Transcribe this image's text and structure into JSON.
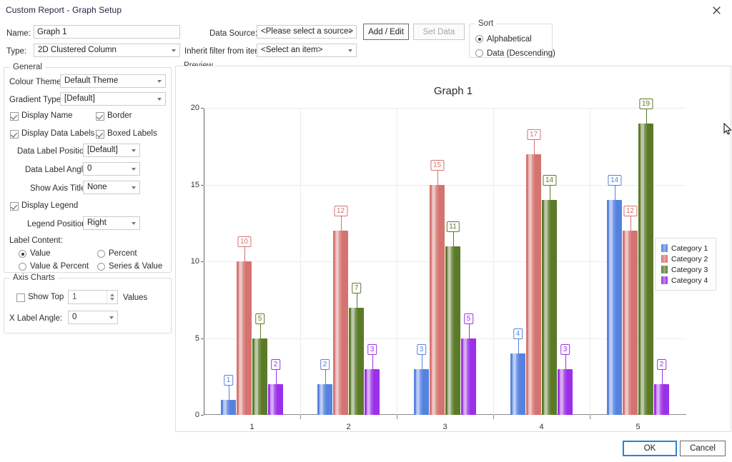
{
  "window": {
    "title": "Custom Report - Graph Setup",
    "close_icon": "close-icon"
  },
  "form": {
    "name_label": "Name:",
    "name_value": "Graph 1",
    "type_label": "Type:",
    "type_value": "2D Clustered Column",
    "data_source_label": "Data Source:",
    "data_source_value": "<Please select a source>",
    "inherit_filter_label": "Inherit filter from item:",
    "inherit_filter_value": "<Select an item>",
    "add_edit_label": "Add / Edit",
    "set_data_label": "Set Data"
  },
  "sort": {
    "title": "Sort",
    "options": [
      {
        "label": "Alphabetical",
        "selected": true
      },
      {
        "label": "Data (Descending)",
        "selected": false
      }
    ]
  },
  "general": {
    "title": "General",
    "colour_theme_label": "Colour Theme:",
    "colour_theme_value": "Default Theme",
    "gradient_type_label": "Gradient Type:",
    "gradient_type_value": "[Default]",
    "display_name_label": "Display Name",
    "display_name_checked": true,
    "border_label": "Border",
    "border_checked": true,
    "display_data_labels_label": "Display Data Labels",
    "display_data_labels_checked": true,
    "boxed_labels_label": "Boxed Labels",
    "boxed_labels_checked": true,
    "data_label_position_label": "Data Label Position:",
    "data_label_position_value": "[Default]",
    "data_label_angle_label": "Data Label Angle:",
    "data_label_angle_value": "0",
    "show_axis_titles_label": "Show Axis Titles:",
    "show_axis_titles_value": "None",
    "display_legend_label": "Display Legend",
    "display_legend_checked": true,
    "legend_position_label": "Legend Position:",
    "legend_position_value": "Right",
    "label_content_label": "Label Content:",
    "label_content_options": [
      {
        "label": "Value",
        "selected": true
      },
      {
        "label": "Percent",
        "selected": false
      },
      {
        "label": "Value & Percent",
        "selected": false
      },
      {
        "label": "Series & Value",
        "selected": false
      }
    ]
  },
  "axis_charts": {
    "title": "Axis Charts",
    "show_top_label": "Show Top",
    "show_top_checked": false,
    "show_top_value": "1",
    "values_label": "Values",
    "x_label_angle_label": "X Label Angle:",
    "x_label_angle_value": "0"
  },
  "preview": {
    "title": "Preview"
  },
  "footer": {
    "ok_label": "OK",
    "cancel_label": "Cancel"
  },
  "chart_data": {
    "type": "bar",
    "title": "Graph 1",
    "xlabel": "",
    "ylabel": "",
    "categories": [
      "1",
      "2",
      "3",
      "4",
      "5"
    ],
    "series": [
      {
        "name": "Category 1",
        "color": "#5581e0",
        "values": [
          1,
          2,
          3,
          4,
          14
        ]
      },
      {
        "name": "Category 2",
        "color": "#d4736f",
        "values": [
          10,
          12,
          15,
          17,
          12
        ]
      },
      {
        "name": "Category 3",
        "color": "#5a7a28",
        "values": [
          5,
          7,
          11,
          14,
          19
        ]
      },
      {
        "name": "Category 4",
        "color": "#9b30e8",
        "values": [
          2,
          3,
          5,
          3,
          2
        ]
      }
    ],
    "ylim": [
      0,
      20
    ],
    "yticks": [
      0,
      5,
      10,
      15,
      20
    ],
    "grid": true,
    "legend_position": "right",
    "data_labels": true
  }
}
